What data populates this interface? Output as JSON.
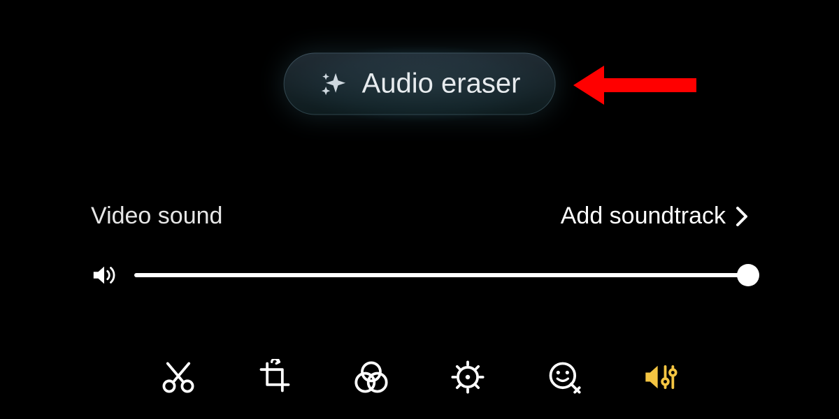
{
  "audio_eraser": {
    "label": "Audio eraser",
    "icon": "sparkle-icon"
  },
  "annotation": {
    "arrow_points_to": "audio-eraser-button",
    "arrow_color": "#ff0000"
  },
  "sound_section": {
    "title": "Video sound",
    "add_soundtrack_label": "Add soundtrack"
  },
  "volume": {
    "value_percent": 100,
    "icon": "speaker-loud-icon"
  },
  "toolbar": {
    "items": [
      {
        "name": "trim",
        "active": false,
        "icon": "scissors-icon"
      },
      {
        "name": "crop",
        "active": false,
        "icon": "crop-rotate-icon"
      },
      {
        "name": "filters",
        "active": false,
        "icon": "filter-circles-icon"
      },
      {
        "name": "adjust",
        "active": false,
        "icon": "adjust-dial-icon"
      },
      {
        "name": "markup",
        "active": false,
        "icon": "emoji-pencil-icon"
      },
      {
        "name": "audio",
        "active": true,
        "icon": "audio-sliders-icon"
      }
    ]
  }
}
